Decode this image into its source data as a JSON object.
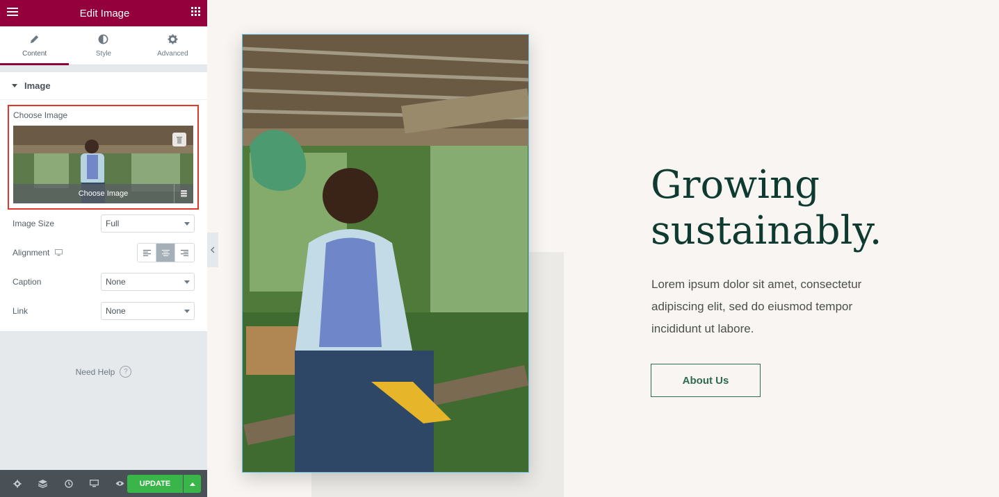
{
  "topbar": {
    "title": "Edit Image"
  },
  "tabs": [
    {
      "label": "Content",
      "icon": "pencil-icon"
    },
    {
      "label": "Style",
      "icon": "contrast-icon"
    },
    {
      "label": "Advanced",
      "icon": "gear-icon"
    }
  ],
  "section": {
    "title": "Image"
  },
  "choose_image": {
    "label": "Choose Image",
    "button": "Choose Image"
  },
  "controls": {
    "image_size": {
      "label": "Image Size",
      "value": "Full"
    },
    "alignment": {
      "label": "Alignment"
    },
    "caption": {
      "label": "Caption",
      "value": "None"
    },
    "link": {
      "label": "Link",
      "value": "None"
    }
  },
  "help": {
    "label": "Need Help",
    "icon": "question-icon"
  },
  "bottombar": {
    "update_label": "UPDATE"
  },
  "hero": {
    "headline_line1": "Growing",
    "headline_line2": "sustainably.",
    "body": "Lorem ipsum dolor sit amet, consectetur adipiscing elit, sed do eiusmod tempor incididunt ut labore.",
    "button": "About Us"
  },
  "colors": {
    "brand": "#93003c",
    "update": "#39b54a",
    "heading": "#0e3a30",
    "button_border": "#2d6a4f",
    "highlight": "#e1362a"
  }
}
